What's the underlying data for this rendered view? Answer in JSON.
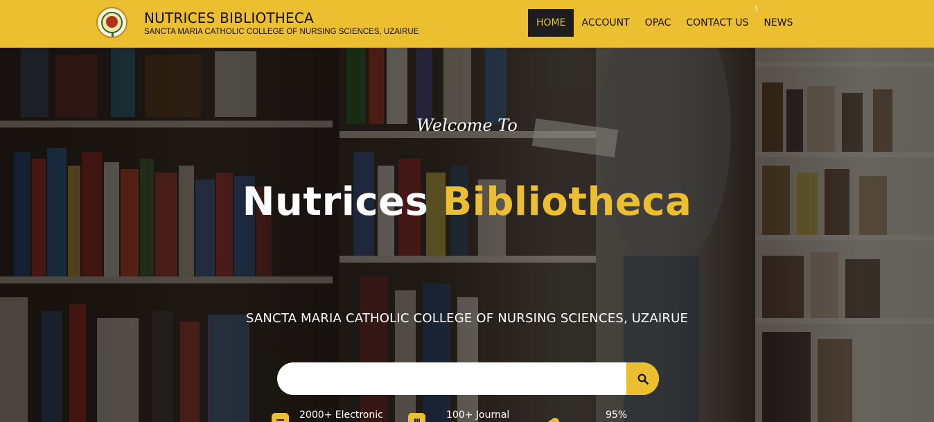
{
  "header": {
    "title": "NUTRICES BIBLIOTHECA",
    "subtitle": "SANCTA MARIA CATHOLIC COLLEGE OF NURSING SCIENCES, UZAIRUE",
    "logo_icon": "college-crest-logo"
  },
  "nav": {
    "items": [
      {
        "label": "HOME"
      },
      {
        "label": "ACCOUNT"
      },
      {
        "label": "OPAC"
      },
      {
        "label": "CONTACT US",
        "badge": "1"
      },
      {
        "label": "NEWS"
      }
    ]
  },
  "hero": {
    "welcome": "Welcome To",
    "title_part1": "Nutrices",
    "title_part2": "Bibliotheca",
    "college": "SANCTA MARIA CATHOLIC COLLEGE OF NURSING SCIENCES, UZAIRUE",
    "search_value": "",
    "search_icon": "search-icon"
  },
  "stats": [
    {
      "icon": "book-icon",
      "label": "2000+ Electronic"
    },
    {
      "icon": "journal-icon",
      "label": "100+ Journal"
    },
    {
      "icon": "cloud-icon",
      "label": "95%"
    }
  ],
  "colors": {
    "accent": "#ecbf31",
    "dark": "#1d1d1d"
  }
}
